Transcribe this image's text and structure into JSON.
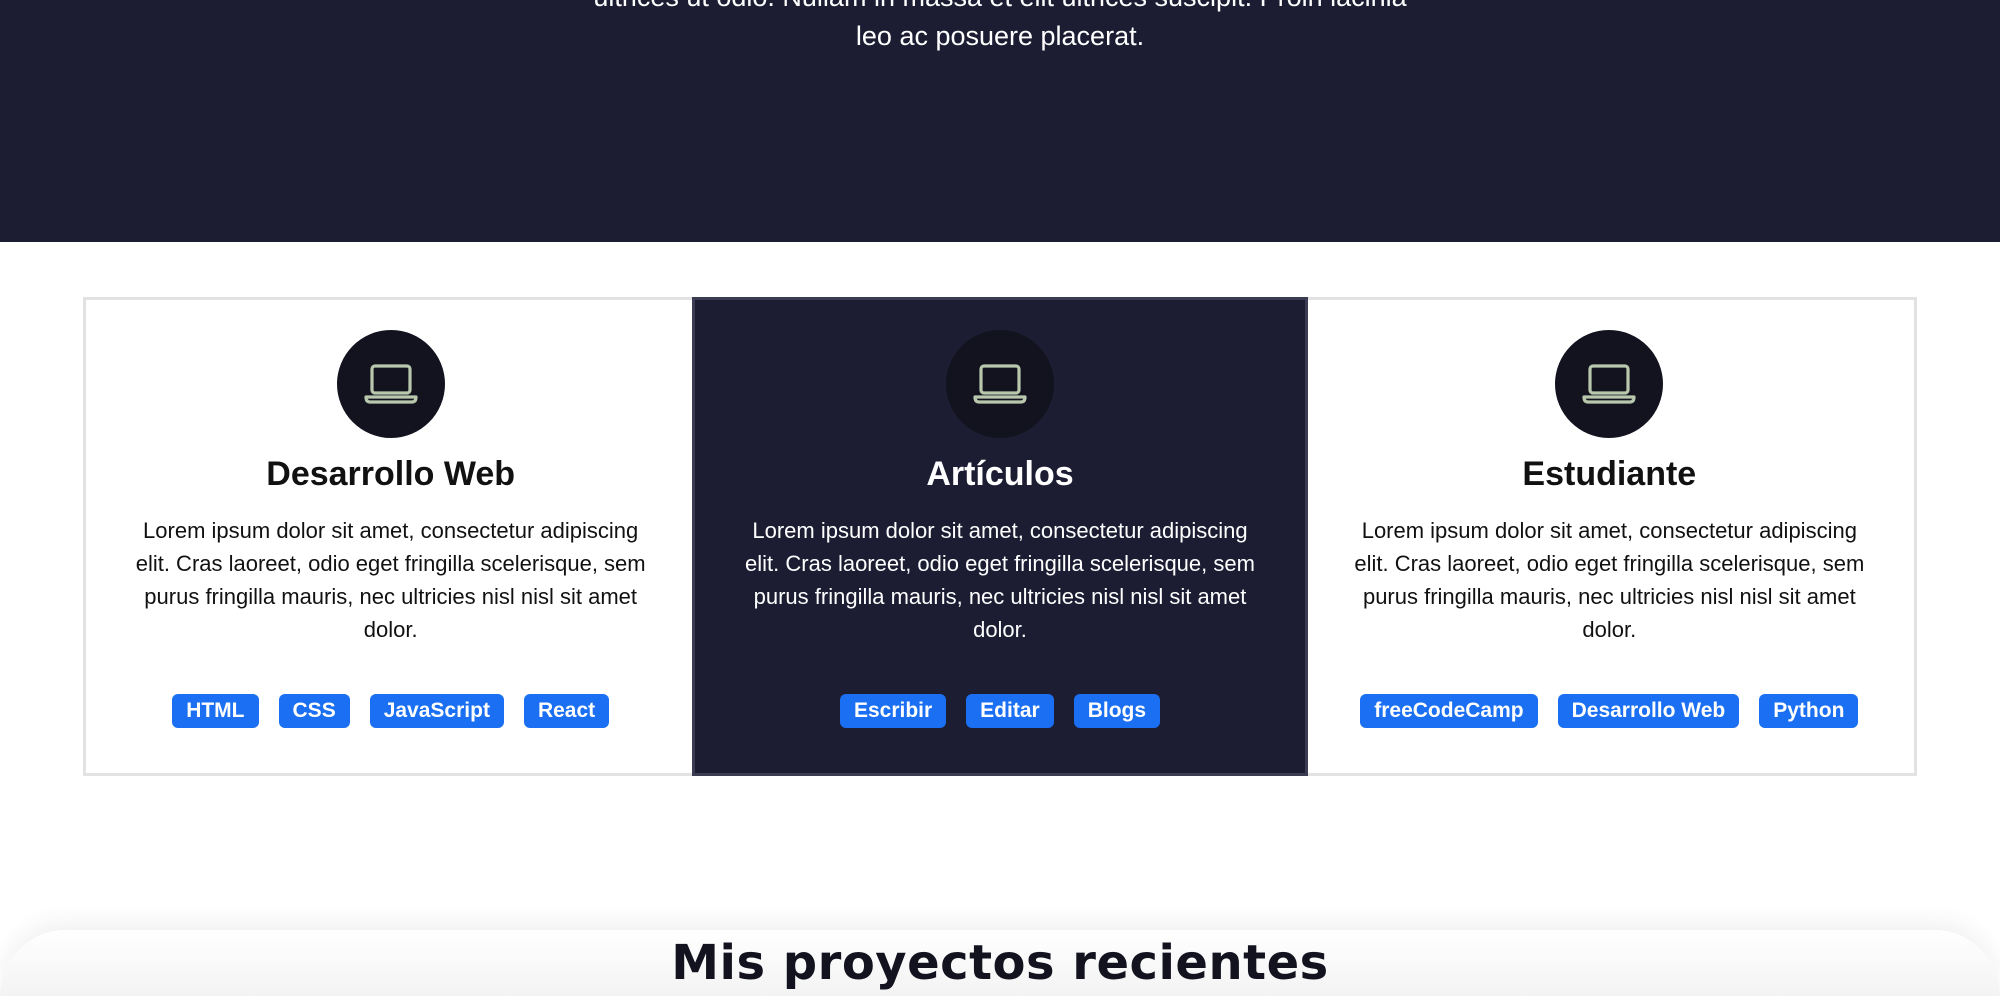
{
  "hero": {
    "lines": [
      "ultrices ut odio. Nullam in massa et elit ultrices suscipit. Proin lacinia",
      "leo ac posuere placerat."
    ]
  },
  "cards": [
    {
      "icon": "laptop-icon",
      "title": "Desarrollo Web",
      "desc": [
        "Lorem ipsum dolor sit amet, consectetur adipiscing",
        "elit. Cras laoreet, odio eget fringilla scelerisque, sem",
        "purus fringilla mauris, nec ultricies nisl nisl sit amet",
        "dolor."
      ],
      "tags": [
        "HTML",
        "CSS",
        "JavaScript",
        "React"
      ]
    },
    {
      "icon": "laptop-icon",
      "title": "Artículos",
      "desc": [
        "Lorem ipsum dolor sit amet, consectetur adipiscing",
        "elit. Cras laoreet, odio eget fringilla scelerisque, sem",
        "purus fringilla mauris, nec ultricies nisl nisl sit amet",
        "dolor."
      ],
      "tags": [
        "Escribir",
        "Editar",
        "Blogs"
      ]
    },
    {
      "icon": "laptop-icon",
      "title": "Estudiante",
      "desc": [
        "Lorem ipsum dolor sit amet, consectetur adipiscing",
        "elit. Cras laoreet, odio eget fringilla scelerisque, sem",
        "purus fringilla mauris, nec ultricies nisl nisl sit amet",
        "dolor."
      ],
      "tags": [
        "freeCodeCamp",
        "Desarrollo Web",
        "Python"
      ]
    }
  ],
  "projects": {
    "title": "Mis proyectos recientes"
  },
  "colors": {
    "hero_bg": "#1c1d33",
    "tag_bg": "#1a6ff2",
    "icon_circle": "#12131f",
    "icon_stroke": "#b9c7ad"
  }
}
